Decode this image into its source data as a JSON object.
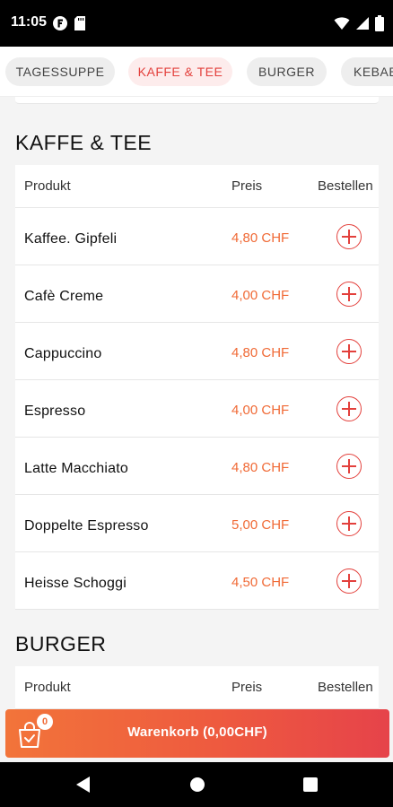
{
  "status_bar": {
    "time": "11:05"
  },
  "categories": [
    {
      "label": "TAGESSUPPE",
      "active": false
    },
    {
      "label": "KAFFE & TEE",
      "active": true
    },
    {
      "label": "BURGER",
      "active": false
    },
    {
      "label": "KEBAB",
      "active": false
    }
  ],
  "sections": [
    {
      "title": "KAFFE & TEE",
      "headers": {
        "product": "Produkt",
        "price": "Preis",
        "order": "Bestellen"
      },
      "items": [
        {
          "name": "Kaffee. Gipfeli",
          "price": "4,80 CHF"
        },
        {
          "name": "Cafè Creme",
          "price": "4,00 CHF"
        },
        {
          "name": "Cappuccino",
          "price": "4,80 CHF"
        },
        {
          "name": "Espresso",
          "price": "4,00 CHF"
        },
        {
          "name": "Latte Macchiato",
          "price": "4,80 CHF"
        },
        {
          "name": "Doppelte Espresso",
          "price": "5,00 CHF"
        },
        {
          "name": "Heisse Schoggi",
          "price": "4,50 CHF"
        }
      ]
    },
    {
      "title": "BURGER",
      "headers": {
        "product": "Produkt",
        "price": "Preis",
        "order": "Bestellen"
      },
      "items": []
    }
  ],
  "cart": {
    "count": "0",
    "label": "Warenkorb (0,00CHF)"
  },
  "colors": {
    "accent": "#e3403c",
    "price": "#f06a36",
    "cart_start": "#f2743a",
    "cart_end": "#e6434a"
  }
}
